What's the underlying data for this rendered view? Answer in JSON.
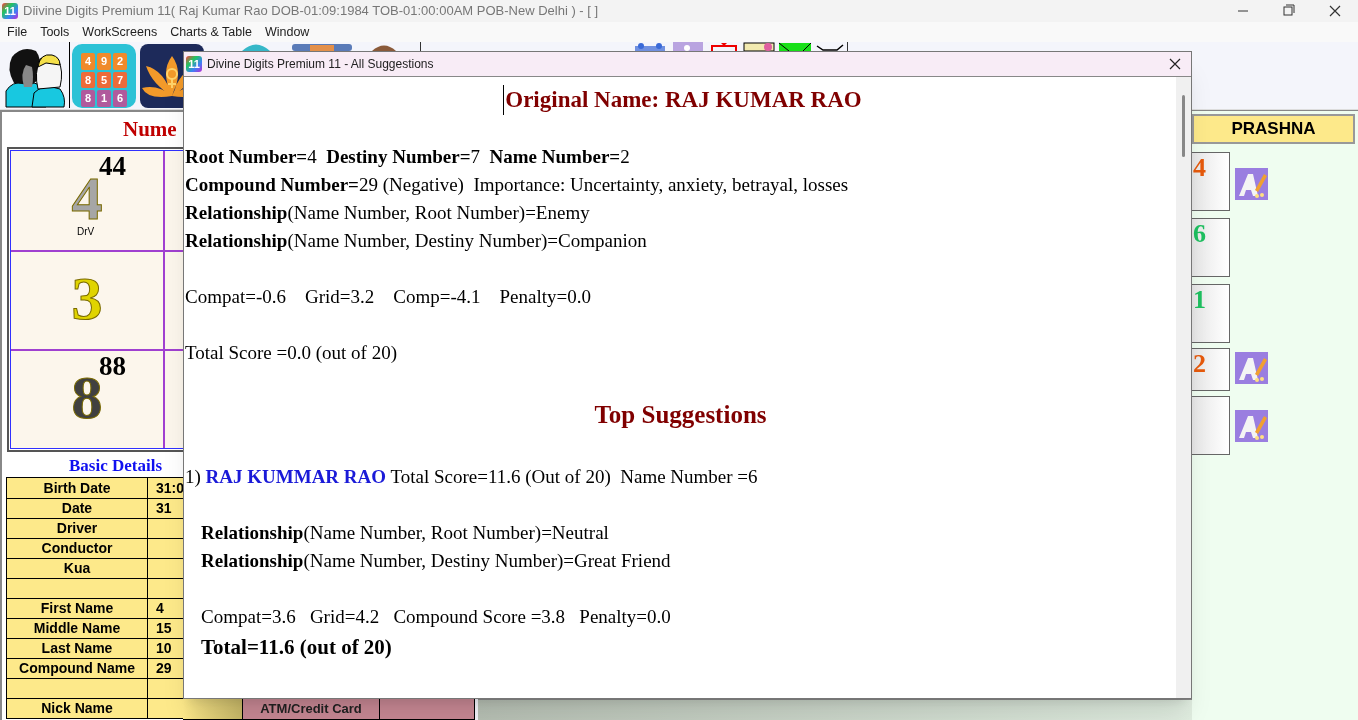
{
  "app_title": {
    "logo": "11",
    "text": "Diivine Digits Premium 11( Raj Kumar Rao DOB-01:09:1984 TOB-01:00:00AM POB-New Delhi ) - [ ]"
  },
  "menu": [
    "File",
    "Tools",
    "WorkScreens",
    "Charts & Table",
    "Window"
  ],
  "toolbar": {
    "magic_square": [
      "4",
      "9",
      "2",
      "8",
      "5",
      "7",
      "8",
      "1",
      "6"
    ]
  },
  "left_panel": {
    "heading": "Nume",
    "grid": [
      {
        "big": "4",
        "sup": "44",
        "sub": "DrV",
        "color": "#a6a6a6"
      },
      {
        "big": "3",
        "color": "#e0d400"
      },
      {
        "big": "8",
        "sup": "88",
        "color": "#404040"
      }
    ],
    "basic_title": "Basic Details",
    "rows": [
      {
        "kind": "row",
        "label": "Birth Date",
        "value": "31:0"
      },
      {
        "kind": "row",
        "label": "Date",
        "value": "31"
      },
      {
        "kind": "row",
        "label": "Driver"
      },
      {
        "kind": "row",
        "label": "Conductor"
      },
      {
        "kind": "row",
        "label": "Kua"
      },
      {
        "kind": "blank"
      },
      {
        "kind": "row",
        "label": "First Name",
        "value": "4"
      },
      {
        "kind": "row",
        "label": "Middle Name",
        "value": "15"
      },
      {
        "kind": "row",
        "label": "Last Name",
        "value": "10"
      },
      {
        "kind": "row",
        "label": "Compound Name",
        "value": "29"
      },
      {
        "kind": "blank"
      },
      {
        "kind": "row",
        "label": "Nick Name"
      }
    ]
  },
  "bottom_strip": {
    "label": "ATM/Credit Card"
  },
  "right_panel": {
    "header": "PRASHNA",
    "cells": [
      {
        "digit": "4",
        "color": "#e65a0c",
        "icon": true
      },
      {
        "digit": "6",
        "color": "#1ec060",
        "icon": false
      },
      {
        "digit": "1",
        "color": "#1ec060",
        "icon": false
      },
      {
        "digit": "2",
        "color": "#e65a0c",
        "icon": true
      },
      {
        "icon": true
      }
    ]
  },
  "dialog": {
    "logo": "11",
    "title": "Divine Digits Premium 11 - All Suggestions",
    "lines": [
      {
        "kind": "title",
        "text": "Original Name: RAJ KUMAR RAO"
      },
      {
        "kind": "gap"
      },
      {
        "kind": "line",
        "text": "**Root Number=**4  **Destiny Number=**7  **Name Number=**2"
      },
      {
        "kind": "line",
        "text": "**Compound Number=**29 (Negative)  Importance: Uncertainty, anxiety, betrayal, losses"
      },
      {
        "kind": "line",
        "text": "**Relationship**(Name Number, Root Number)=Enemy"
      },
      {
        "kind": "line",
        "text": "**Relationship**(Name Number, Destiny Number)=Companion"
      },
      {
        "kind": "gap"
      },
      {
        "kind": "line",
        "text": "Compat=-0.6    Grid=3.2    Comp=-4.1    Penalty=0.0"
      },
      {
        "kind": "gap"
      },
      {
        "kind": "line",
        "text": "Total Score =0.0 (out of 20)"
      },
      {
        "kind": "gap"
      },
      {
        "kind": "section",
        "text": "Top Suggestions"
      },
      {
        "kind": "gap"
      },
      {
        "kind": "suggestion",
        "index": "1)",
        "name": "RAJ KUMMAR RAO",
        "text": "Total Score=11.6 (Out of 20)  Name Number =6"
      },
      {
        "kind": "gap"
      },
      {
        "kind": "indent",
        "text": "**Relationship**(Name Number, Root Number)=Neutral"
      },
      {
        "kind": "indent",
        "text": "**Relationship**(Name Number, Destiny Number)=Great Friend"
      },
      {
        "kind": "gap"
      },
      {
        "kind": "indent",
        "text": "Compat=3.6   Grid=4.2   Compound Score =3.8   Penalty=0.0"
      },
      {
        "kind": "total",
        "text": "Total=11.6 (out of 20)"
      }
    ]
  }
}
